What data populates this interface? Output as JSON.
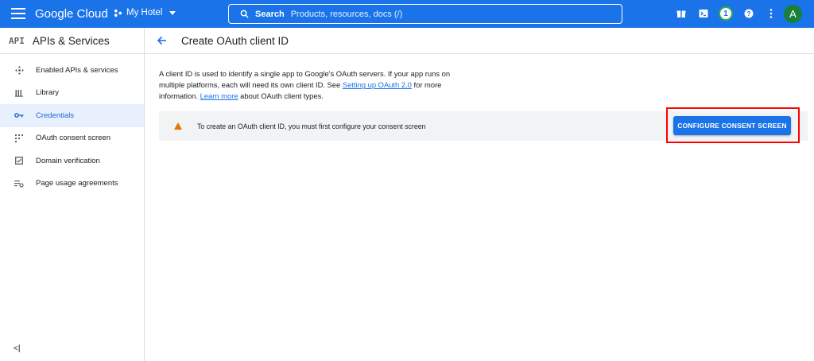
{
  "topbar": {
    "logo": "Google Cloud",
    "project": "My Hotel",
    "search_label": "Search",
    "search_placeholder": "Products, resources, docs (/)",
    "notification_count": "1",
    "avatar_letter": "A"
  },
  "sidebar": {
    "badge": "API",
    "title": "APIs & Services",
    "items": [
      {
        "label": "Enabled APIs & services",
        "icon": "move-icon"
      },
      {
        "label": "Library",
        "icon": "library-icon"
      },
      {
        "label": "Credentials",
        "icon": "key-icon",
        "active": true
      },
      {
        "label": "OAuth consent screen",
        "icon": "consent-icon"
      },
      {
        "label": "Domain verification",
        "icon": "checkbox-icon"
      },
      {
        "label": "Page usage agreements",
        "icon": "settings-list-icon"
      }
    ],
    "collapse": "<|"
  },
  "page": {
    "title": "Create OAuth client ID",
    "intro_1": "A client ID is used to identify a single app to Google's OAuth servers. If your app runs on multiple platforms, each will need its own client ID. See ",
    "intro_link_1": "Setting up OAuth 2.0",
    "intro_2": " for more information. ",
    "intro_link_2": "Learn more",
    "intro_3": " about OAuth client types.",
    "banner_text": "To create an OAuth client ID, you must first configure your consent screen",
    "button": "CONFIGURE CONSENT SCREEN"
  },
  "colors": {
    "brand": "#1a73e8",
    "warning": "#e37400",
    "highlight": "#ff0000"
  }
}
